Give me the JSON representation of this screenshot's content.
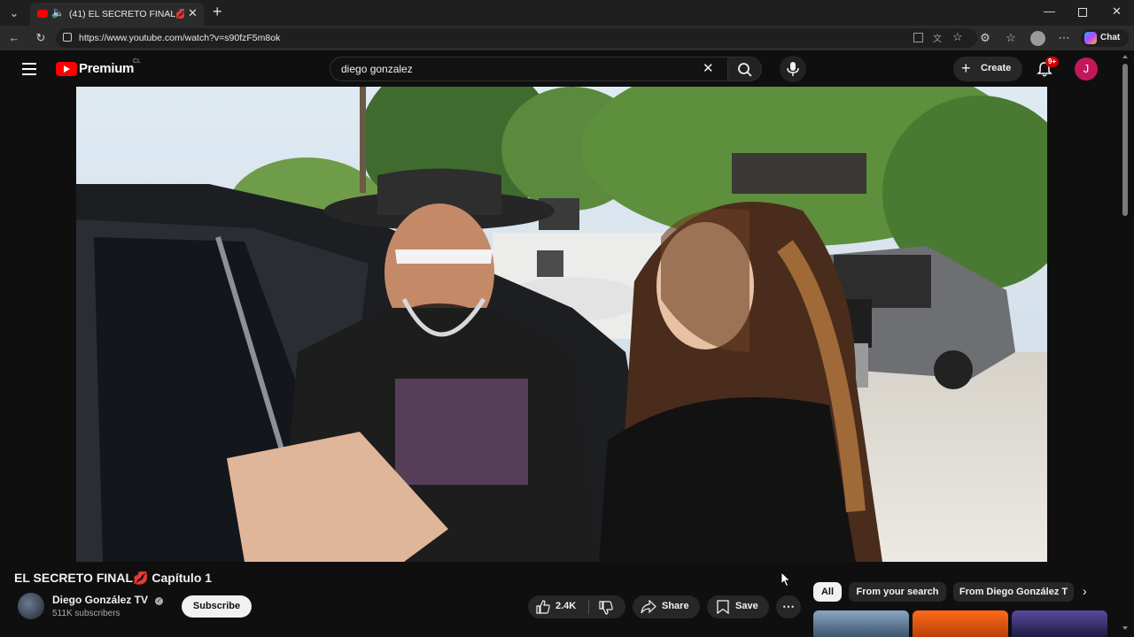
{
  "browser": {
    "tab_title": "(41) EL SECRETO FINAL💋 Ca",
    "url": "https://www.youtube.com/watch?v=s90fzF5m8ok",
    "chat_label": "Chat",
    "new_tab": "+"
  },
  "youtube": {
    "logo_text": "Premium",
    "region": "CL",
    "search_value": "diego gonzalez",
    "create_label": "Create",
    "notification_badge": "9+",
    "avatar_letter": "J",
    "accent": "#ff0000"
  },
  "video": {
    "title": "EL SECRETO FINAL💋 Capítulo 1",
    "channel_name": "Diego González TV",
    "subscribers": "511K subscribers",
    "subscribe_label": "Subscribe",
    "likes": "2.4K",
    "share_label": "Share",
    "save_label": "Save"
  },
  "chips": [
    "All",
    "From your search",
    "From Diego González T"
  ]
}
